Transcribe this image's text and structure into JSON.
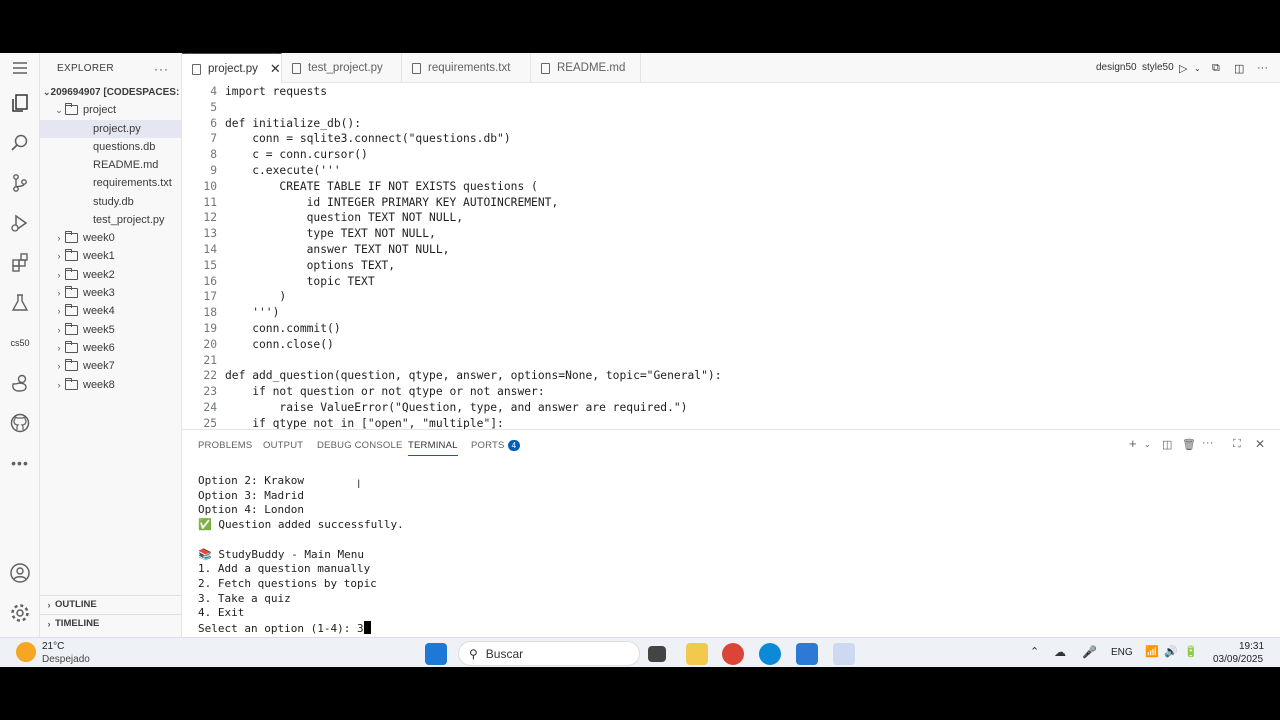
{
  "explorer": {
    "title": "EXPLORER",
    "root": "209694907 [CODESPACES: ...",
    "project_folder": "project",
    "files": [
      "project.py",
      "questions.db",
      "README.md",
      "requirements.txt",
      "study.db",
      "test_project.py"
    ],
    "folders": [
      "week0",
      "week1",
      "week2",
      "week3",
      "week4",
      "week5",
      "week6",
      "week7",
      "week8"
    ],
    "outline": "OUTLINE",
    "timeline": "TIMELINE"
  },
  "tabs": [
    "project.py",
    "test_project.py",
    "requirements.txt",
    "README.md"
  ],
  "toolbar": {
    "item1": "design50",
    "item2": "style50"
  },
  "activity": {
    "cs50_label": "cs50"
  },
  "editor": {
    "lines": [
      {
        "n": "4",
        "t": "import requests"
      },
      {
        "n": "5",
        "t": ""
      },
      {
        "n": "6",
        "t": "def initialize_db():"
      },
      {
        "n": "7",
        "t": "    conn = sqlite3.connect(\"questions.db\")"
      },
      {
        "n": "8",
        "t": "    c = conn.cursor()"
      },
      {
        "n": "9",
        "t": "    c.execute('''"
      },
      {
        "n": "10",
        "t": "        CREATE TABLE IF NOT EXISTS questions ("
      },
      {
        "n": "11",
        "t": "            id INTEGER PRIMARY KEY AUTOINCREMENT,"
      },
      {
        "n": "12",
        "t": "            question TEXT NOT NULL,"
      },
      {
        "n": "13",
        "t": "            type TEXT NOT NULL,"
      },
      {
        "n": "14",
        "t": "            answer TEXT NOT NULL,"
      },
      {
        "n": "15",
        "t": "            options TEXT,"
      },
      {
        "n": "16",
        "t": "            topic TEXT"
      },
      {
        "n": "17",
        "t": "        )"
      },
      {
        "n": "18",
        "t": "    ''')"
      },
      {
        "n": "19",
        "t": "    conn.commit()"
      },
      {
        "n": "20",
        "t": "    conn.close()"
      },
      {
        "n": "21",
        "t": ""
      },
      {
        "n": "22",
        "t": "def add_question(question, qtype, answer, options=None, topic=\"General\"):"
      },
      {
        "n": "23",
        "t": "    if not question or not qtype or not answer:"
      },
      {
        "n": "24",
        "t": "        raise ValueError(\"Question, type, and answer are required.\")"
      },
      {
        "n": "25",
        "t": "    if qtype not in [\"open\", \"multiple\"]:"
      }
    ]
  },
  "panel": {
    "tabs": [
      "PROBLEMS",
      "OUTPUT",
      "DEBUG CONSOLE",
      "TERMINAL",
      "PORTS"
    ],
    "ports_count": "4",
    "terminal_lines": [
      "Option 2: Krakow",
      "Option 3: Madrid",
      "Option 4: London",
      "✅ Question added successfully.",
      "",
      "📚 StudyBuddy - Main Menu",
      "1. Add a question manually",
      "2. Fetch questions by topic",
      "3. Take a quiz",
      "4. Exit"
    ],
    "prompt": "Select an option (1-4): 3"
  },
  "taskbar": {
    "temp": "21°C",
    "weather": "Despejado",
    "search_placeholder": "Buscar",
    "lang": "ENG",
    "time": "19:31",
    "date": "03/09/2025"
  }
}
